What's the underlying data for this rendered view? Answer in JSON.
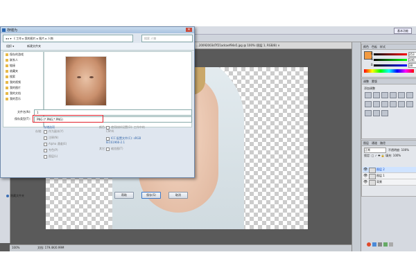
{
  "photoshop": {
    "workspace_label": "基本功能",
    "document_tab": "...20092003d7f21adcaef94e5.jpg @ 100% (图层 1, RGB/8) ×",
    "status_zoom": "100%",
    "status_doc": "文档: 179.4K/0.99M",
    "panels": {
      "color_tabs": [
        "颜色",
        "色板",
        "样式"
      ],
      "color": {
        "r": "253",
        "g": "146",
        "b": "38",
        "fg_color": "#f29a40"
      },
      "adjust_tabs": [
        "调整",
        "蒙版"
      ],
      "adjust_title": "添加调整",
      "layers_tabs": [
        "图层",
        "通道",
        "路径"
      ],
      "blend_mode": "正常",
      "opacity_label": "不透明度: 100%",
      "lock_label": "锁定: □ ✓ ✚ 🔒   填充: 100%",
      "layers": [
        {
          "name": "图层 2",
          "selected": true
        },
        {
          "name": "图层 1",
          "selected": false
        },
        {
          "name": "背景",
          "selected": false
        }
      ]
    }
  },
  "dialog": {
    "title": "存储为",
    "close_label": "✕",
    "address": "◂ ▸ ▾ 《 工作 ▸ 我的图片 ▸ 图片 ▸ 人物",
    "search_placeholder": "搜索 人物",
    "toolbar": {
      "organize": "组织 ▾",
      "new_folder": "新建文件夹"
    },
    "nav_items": [
      "保存的游戏",
      "联系人",
      "链接",
      "收藏夹",
      "搜索",
      "我的视频",
      "我的图片",
      "我的文档",
      "我的音乐"
    ],
    "file_name_label": "文件名(N):",
    "file_name_value": "1",
    "format_label": "保存类型(T):",
    "format_value": "PNG (*.PNG;*.PNG)",
    "storage_options_title": "存储选项",
    "storage_label": "存储:",
    "storage_options": [
      "作为副本(Y)",
      "注释(N)",
      "Alpha 通道(E)",
      "专色(P)",
      "图层(L)"
    ],
    "color_label": "颜色:",
    "proof_option": "使用校样设置(O): 工作中的 CMYK",
    "icc_option": "ICC 配置文件(C): sRGB IEC61966-2.1",
    "other_label": "其它:",
    "thumbnail_option": "缩览图(T)",
    "hide_folders": "隐藏文件夹",
    "buttons": {
      "help": "帮助",
      "save": "保存(S)",
      "cancel": "取消"
    }
  }
}
